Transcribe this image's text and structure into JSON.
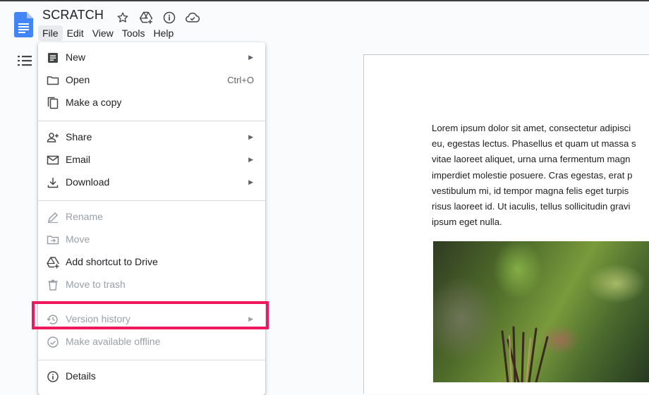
{
  "doc": {
    "title": "SCRATCH"
  },
  "menubar": [
    "File",
    "Edit",
    "View",
    "Tools",
    "Help"
  ],
  "file_menu": {
    "items": [
      {
        "label": "New",
        "icon": "new-doc-icon",
        "submenu": true,
        "shortcut": ""
      },
      {
        "label": "Open",
        "icon": "folder-icon",
        "submenu": false,
        "shortcut": "Ctrl+O"
      },
      {
        "label": "Make a copy",
        "icon": "copy-icon",
        "submenu": false,
        "shortcut": ""
      },
      {
        "label": "Share",
        "icon": "person-add-icon",
        "submenu": true,
        "shortcut": ""
      },
      {
        "label": "Email",
        "icon": "mail-icon",
        "submenu": true,
        "shortcut": ""
      },
      {
        "label": "Download",
        "icon": "download-icon",
        "submenu": true,
        "shortcut": ""
      },
      {
        "label": "Rename",
        "icon": "rename-icon",
        "submenu": false,
        "shortcut": "",
        "disabled": true
      },
      {
        "label": "Move",
        "icon": "move-folder-icon",
        "submenu": false,
        "shortcut": "",
        "disabled": true
      },
      {
        "label": "Add shortcut to Drive",
        "icon": "drive-add-icon",
        "submenu": false,
        "shortcut": ""
      },
      {
        "label": "Move to trash",
        "icon": "trash-icon",
        "submenu": false,
        "shortcut": "",
        "disabled": true
      },
      {
        "label": "Version history",
        "icon": "history-icon",
        "submenu": true,
        "shortcut": "",
        "disabled": true
      },
      {
        "label": "Make available offline",
        "icon": "offline-icon",
        "submenu": false,
        "shortcut": "",
        "disabled": true
      },
      {
        "label": "Details",
        "icon": "info-icon",
        "submenu": false,
        "shortcut": ""
      }
    ]
  },
  "document": {
    "lines": [
      "Lorem ipsum dolor sit amet, consectetur adipisci",
      "eu, egestas lectus. Phasellus et quam ut massa s",
      "vitae laoreet aliquet, urna urna fermentum magn",
      "imperdiet molestie posuere. Cras egestas, erat p",
      "vestibulum mi, id tempor magna felis eget turpis",
      "risus laoreet id. Ut iaculis, tellus sollicitudin gravi",
      "ipsum eget nulla."
    ]
  },
  "colors": {
    "docs_blue": "#4285f4",
    "highlight": "#f0185c",
    "disabled_text": "#9aa0a6"
  }
}
